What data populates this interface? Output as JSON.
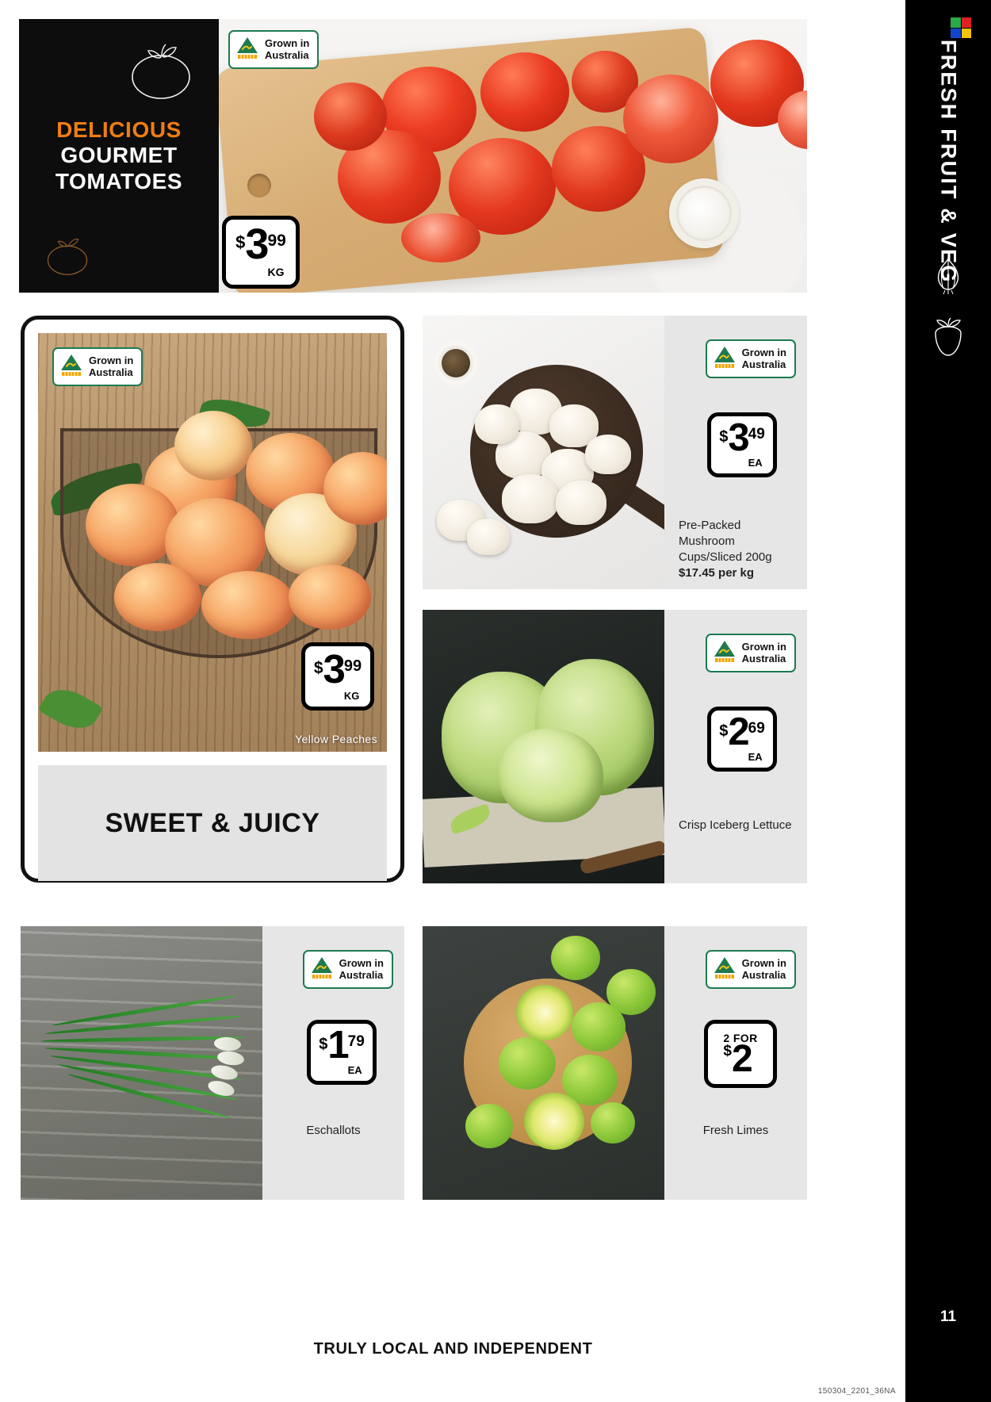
{
  "sidebar": {
    "title": "FRESH FRUIT & VEG",
    "page_number": "11",
    "logo_colors": [
      "#2aa84a",
      "#e02020",
      "#1246c8",
      "#f2c300"
    ],
    "icons": [
      "garlic-icon",
      "strawberry-icon"
    ]
  },
  "hero": {
    "headline_line1": "DELICIOUS",
    "headline_line2": "GOURMET",
    "headline_line3": "TOMATOES",
    "accent_color": "#ef7d12",
    "badge": {
      "line1": "Grown in",
      "line2": "Australia"
    },
    "price": {
      "currency": "$",
      "whole": "3",
      "cents": "99",
      "unit": "KG"
    }
  },
  "feature": {
    "badge": {
      "line1": "Grown in",
      "line2": "Australia"
    },
    "caption": "Yellow Peaches",
    "price": {
      "currency": "$",
      "whole": "3",
      "cents": "99",
      "unit": "KG"
    },
    "banner_text": "SWEET & JUICY"
  },
  "products": [
    {
      "id": "mushrooms",
      "badge": {
        "line1": "Grown in",
        "line2": "Australia"
      },
      "price": {
        "currency": "$",
        "whole": "3",
        "cents": "49",
        "unit": "EA"
      },
      "desc_line1": "Pre-Packed Mushroom",
      "desc_line2": "Cups/Sliced 200g",
      "desc_line3": "$17.45 per kg"
    },
    {
      "id": "lettuce",
      "badge": {
        "line1": "Grown in",
        "line2": "Australia"
      },
      "price": {
        "currency": "$",
        "whole": "2",
        "cents": "69",
        "unit": "EA"
      },
      "desc_line1": "Crisp Iceberg Lettuce"
    },
    {
      "id": "eschallots",
      "badge": {
        "line1": "Grown in",
        "line2": "Australia"
      },
      "price": {
        "currency": "$",
        "whole": "1",
        "cents": "79",
        "unit": "EA"
      },
      "desc_line1": "Eschallots"
    },
    {
      "id": "limes",
      "badge": {
        "line1": "Grown in",
        "line2": "Australia"
      },
      "price": {
        "for_label": "2 FOR",
        "currency": "$",
        "whole": "2"
      },
      "desc_line1": "Fresh Limes"
    }
  ],
  "footer": {
    "tagline": "TRULY LOCAL AND INDEPENDENT",
    "code": "150304_2201_36NA"
  }
}
